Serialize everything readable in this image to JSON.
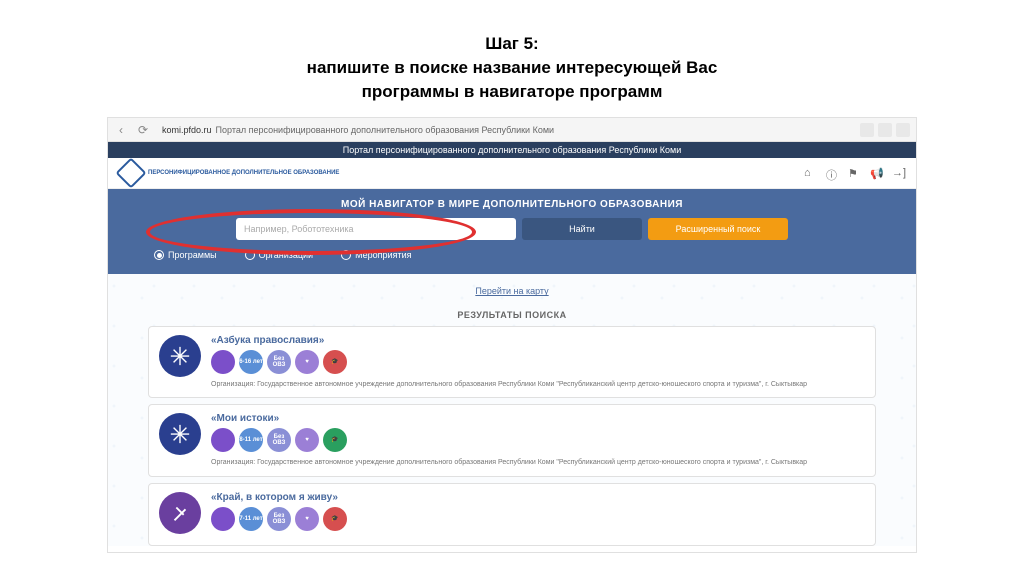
{
  "slide": {
    "title_line1": "Шаг 5:",
    "title_line2": "напишите в поиске название интересующей Вас",
    "title_line3": "программы в навигаторе программ"
  },
  "browser": {
    "url_host": "komi.pfdo.ru",
    "url_title": "Портал персонифицированного дополнительного образования Республики Коми"
  },
  "portal": {
    "strip": "Портал персонифицированного дополнительного образования Республики Коми",
    "logo_text": "ПЕРСОНИФИЦИРОВАННОЕ ДОПОЛНИТЕЛЬНОЕ ОБРАЗОВАНИЕ",
    "hero_title": "МОЙ НАВИГАТОР В МИРЕ ДОПОЛНИТЕЛЬНОГО ОБРАЗОВАНИЯ",
    "search_placeholder": "Например, Робототехника",
    "btn_find": "Найти",
    "btn_advanced": "Расширенный поиск",
    "radios": [
      {
        "label": "Программы",
        "checked": true
      },
      {
        "label": "Организации",
        "checked": false
      },
      {
        "label": "Мероприятия",
        "checked": false
      }
    ],
    "map_link": "Перейти на карту",
    "results_title": "РЕЗУЛЬТАТЫ ПОИСКА"
  },
  "results": [
    {
      "title": "«Азбука православия»",
      "icon_style": "blue",
      "badges": [
        {
          "cls": "b1",
          "text": ""
        },
        {
          "cls": "b2",
          "text": "6-16 лет"
        },
        {
          "cls": "b3",
          "text": "Без ОВЗ"
        },
        {
          "cls": "b4",
          "text": "♥"
        },
        {
          "cls": "b5",
          "text": "🎓"
        }
      ],
      "org": "Организация: Государственное автономное учреждение дополнительного образования Республики Коми \"Республиканский центр детско-юношеского спорта и туризма\", г. Сыктывкар"
    },
    {
      "title": "«Мои истоки»",
      "icon_style": "blue",
      "badges": [
        {
          "cls": "b1",
          "text": ""
        },
        {
          "cls": "b2",
          "text": "8-11 лет"
        },
        {
          "cls": "b3",
          "text": "Без ОВЗ"
        },
        {
          "cls": "b4",
          "text": "♥"
        },
        {
          "cls": "b6",
          "text": "🎓"
        }
      ],
      "org": "Организация: Государственное автономное учреждение дополнительного образования Республики Коми \"Республиканский центр детско-юношеского спорта и туризма\", г. Сыктывкар"
    },
    {
      "title": "«Край, в котором я живу»",
      "icon_style": "purple",
      "badges": [
        {
          "cls": "b1",
          "text": ""
        },
        {
          "cls": "b2",
          "text": "7-11 лет"
        },
        {
          "cls": "b3",
          "text": "Без ОВЗ"
        },
        {
          "cls": "b4",
          "text": "♥"
        },
        {
          "cls": "b5",
          "text": "🎓"
        }
      ],
      "org": ""
    }
  ]
}
